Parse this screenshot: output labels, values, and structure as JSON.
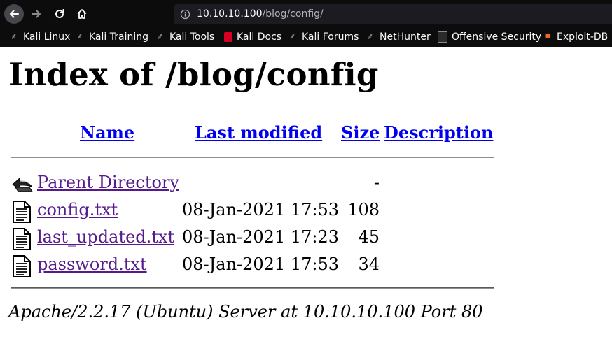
{
  "browser": {
    "url_prefix": "10.10.10.100",
    "url_path": "/blog/config/",
    "bookmarks": [
      {
        "label": "Kali Linux",
        "icon": "kali-dragon-icon"
      },
      {
        "label": "Kali Training",
        "icon": "kali-dragon-icon"
      },
      {
        "label": "Kali Tools",
        "icon": "kali-dragon-icon"
      },
      {
        "label": "Kali Docs",
        "icon": "kali-docs-icon"
      },
      {
        "label": "Kali Forums",
        "icon": "kali-dragon-icon"
      },
      {
        "label": "NetHunter",
        "icon": "nethunter-icon"
      },
      {
        "label": "Offensive Security",
        "icon": "offsec-icon"
      },
      {
        "label": "Exploit-DB",
        "icon": "exploit-db-icon"
      }
    ]
  },
  "page": {
    "title": "Index of /blog/config",
    "columns": {
      "name": "Name",
      "last_modified": "Last modified",
      "size": "Size",
      "description": "Description"
    },
    "rows": [
      {
        "name": "Parent Directory",
        "date": "",
        "size": "-",
        "icon": "back-folder-icon"
      },
      {
        "name": "config.txt",
        "date": "08-Jan-2021 17:53",
        "size": "108",
        "icon": "text-file-icon"
      },
      {
        "name": "last_updated.txt",
        "date": "08-Jan-2021 17:23",
        "size": "45",
        "icon": "text-file-icon"
      },
      {
        "name": "password.txt",
        "date": "08-Jan-2021 17:53",
        "size": "34",
        "icon": "text-file-icon"
      }
    ],
    "footer": "Apache/2.2.17 (Ubuntu) Server at 10.10.10.100 Port 80"
  },
  "colors": {
    "link_header": "#0000ee",
    "link_visited": "#551a8b",
    "chrome_bg": "#0c0c0d"
  }
}
